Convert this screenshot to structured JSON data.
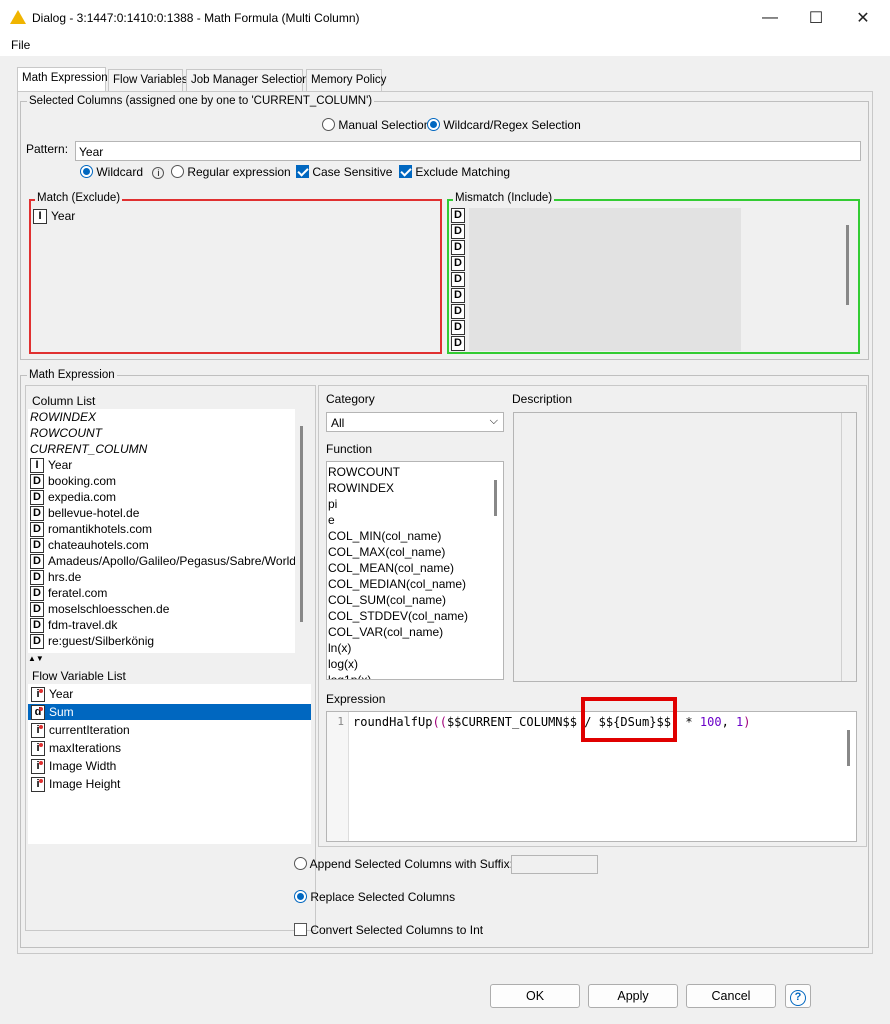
{
  "window": {
    "title": "Dialog - 3:1447:0:1410:0:1388 - Math Formula (Multi Column)",
    "minimize": "—",
    "maximize": "☐",
    "close": "✕"
  },
  "menu": {
    "file": "File"
  },
  "tabs": [
    "Math Expression",
    "Flow Variables",
    "Job Manager Selection",
    "Memory Policy"
  ],
  "selected_columns": {
    "title": "Selected Columns (assigned one by one to 'CURRENT_COLUMN')",
    "manual_selection": "Manual Selection",
    "wildcard_selection": "Wildcard/Regex Selection",
    "pattern_label": "Pattern:",
    "pattern_value": "Year",
    "wildcard": "Wildcard",
    "regular_expression": "Regular expression",
    "case_sensitive": "Case Sensitive",
    "exclude_matching": "Exclude Matching",
    "match_title": "Match (Exclude)",
    "mismatch_title": "Mismatch (Include)",
    "match_items": [
      {
        "type": "I",
        "name": "Year"
      }
    ],
    "mismatch_types": [
      "D",
      "D",
      "D",
      "D",
      "D",
      "D",
      "D",
      "D",
      "D"
    ]
  },
  "math": {
    "title": "Math Expression",
    "column_list_title": "Column List",
    "column_list": [
      {
        "type": "",
        "name": "ROWINDEX",
        "italic": true
      },
      {
        "type": "",
        "name": "ROWCOUNT",
        "italic": true
      },
      {
        "type": "",
        "name": "CURRENT_COLUMN",
        "italic": true
      },
      {
        "type": "I",
        "name": "Year"
      },
      {
        "type": "D",
        "name": "booking.com"
      },
      {
        "type": "D",
        "name": "expedia.com"
      },
      {
        "type": "D",
        "name": "bellevue-hotel.de"
      },
      {
        "type": "D",
        "name": "romantikhotels.com"
      },
      {
        "type": "D",
        "name": "chateauhotels.com"
      },
      {
        "type": "D",
        "name": "Amadeus/Apollo/Galileo/Pegasus/Sabre/Worldspan"
      },
      {
        "type": "D",
        "name": "hrs.de"
      },
      {
        "type": "D",
        "name": "feratel.com"
      },
      {
        "type": "D",
        "name": "moselschloesschen.de"
      },
      {
        "type": "D",
        "name": "fdm-travel.dk"
      },
      {
        "type": "D",
        "name": "re:guest/Silberkönig"
      }
    ],
    "flow_var_title": "Flow Variable List",
    "flow_vars": [
      {
        "type": "i",
        "name": "Year"
      },
      {
        "type": "d",
        "name": "Sum",
        "selected": true
      },
      {
        "type": "i",
        "name": "currentIteration"
      },
      {
        "type": "i",
        "name": "maxIterations"
      },
      {
        "type": "i",
        "name": "Image Width"
      },
      {
        "type": "i",
        "name": "Image Height"
      }
    ],
    "category_label": "Category",
    "category_value": "All",
    "function_label": "Function",
    "functions": [
      "ROWCOUNT",
      "ROWINDEX",
      "pi",
      "e",
      "COL_MIN(col_name)",
      "COL_MAX(col_name)",
      "COL_MEAN(col_name)",
      "COL_MEDIAN(col_name)",
      "COL_SUM(col_name)",
      "COL_STDDEV(col_name)",
      "COL_VAR(col_name)",
      "ln(x)",
      "log(x)",
      "log1p(x)"
    ],
    "description_label": "Description",
    "expression_label": "Expression",
    "line_number": "1",
    "expr_fn": "roundHalfUp",
    "expr_open": "((",
    "expr_col": "$$CURRENT_COLUMN$$",
    "expr_div": " / ",
    "expr_var_a": "$${",
    "expr_var_b": "DSum",
    "expr_var_c": "}$$",
    "expr_close": ")",
    "expr_mul": " * ",
    "expr_num1": "100",
    "expr_comma": ", ",
    "expr_num2": "1",
    "expr_end": ")"
  },
  "options": {
    "append_suffix": "Append Selected Columns with Suffix:",
    "replace": "Replace Selected Columns",
    "convert_int": "Convert Selected Columns to Int"
  },
  "buttons": {
    "ok": "OK",
    "apply": "Apply",
    "cancel": "Cancel",
    "help": "?"
  },
  "colors": {
    "accent": "#0067c0",
    "match_border": "#e03030",
    "mismatch_border": "#33cc33",
    "highlight_box": "#e00000"
  }
}
